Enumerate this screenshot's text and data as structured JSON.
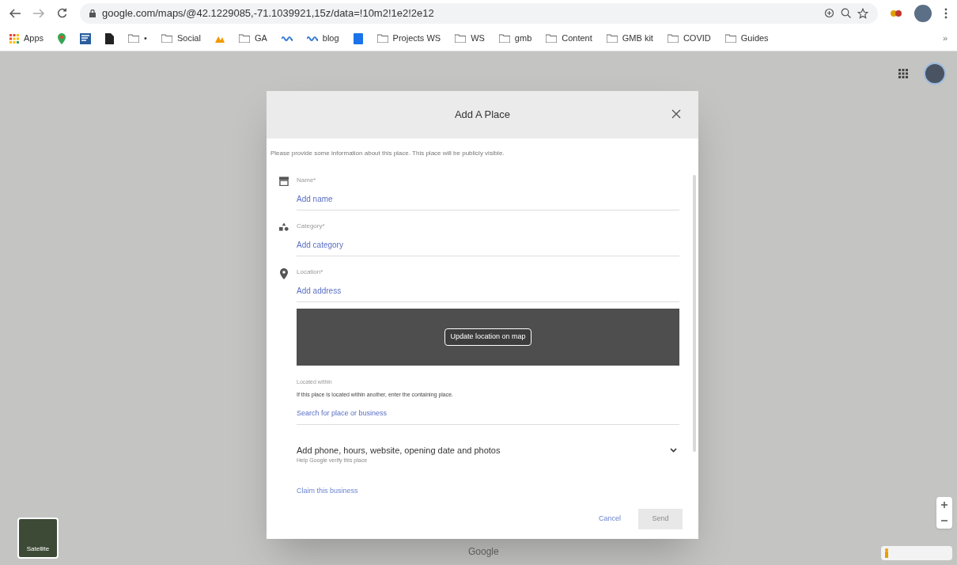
{
  "browser": {
    "url": "google.com/maps/@42.1229085,-71.1039921,15z/data=!10m2!1e2!2e12"
  },
  "bookmarks": [
    {
      "kind": "apps",
      "label": "Apps"
    },
    {
      "kind": "pin"
    },
    {
      "kind": "app"
    },
    {
      "kind": "doc"
    },
    {
      "kind": "folder",
      "label": "•"
    },
    {
      "kind": "folder",
      "label": "Social"
    },
    {
      "kind": "chart"
    },
    {
      "kind": "folder",
      "label": "GA"
    },
    {
      "kind": "wave"
    },
    {
      "kind": "site",
      "label": "blog"
    },
    {
      "kind": "square"
    },
    {
      "kind": "folder",
      "label": "Projects WS"
    },
    {
      "kind": "folder",
      "label": "WS"
    },
    {
      "kind": "folder",
      "label": "gmb"
    },
    {
      "kind": "folder",
      "label": "Content"
    },
    {
      "kind": "folder",
      "label": "GMB kit"
    },
    {
      "kind": "folder",
      "label": "COVID"
    },
    {
      "kind": "folder",
      "label": "Guides"
    }
  ],
  "bookmarks_more": "»",
  "map": {
    "satellite_label": "Satellite",
    "logo": "Google"
  },
  "dialog": {
    "title": "Add A Place",
    "intro": "Please provide some information about this place. This place will be publicly visible.",
    "fields": [
      {
        "kind": "store",
        "label": "Name*",
        "placeholder": "Add name"
      },
      {
        "kind": "category",
        "label": "Category*",
        "placeholder": "Add category"
      },
      {
        "kind": "location",
        "label": "Location*",
        "placeholder": "Add address"
      }
    ],
    "map_button": "Update location on map",
    "located_within": {
      "label": "Located within",
      "help": "If this place is located within another, enter the containing place.",
      "placeholder": "Search for place or business"
    },
    "more": {
      "title": "Add phone, hours, website, opening date and photos",
      "subtitle": "Help Google verify this place",
      "expanded": false
    },
    "claim_link": "Claim this business",
    "cancel": "Cancel",
    "send": {
      "label": "Send",
      "disabled": true
    }
  }
}
